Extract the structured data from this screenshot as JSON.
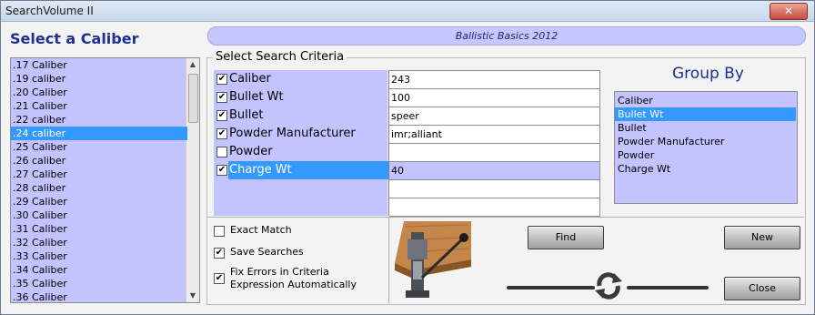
{
  "window": {
    "title": "SearchVolume II",
    "close_glyph": "✕"
  },
  "caliber_panel": {
    "heading": "Select a Caliber",
    "items": [
      ".17 Caliber",
      ".19 caliber",
      ".20 Caliber",
      ".21 Caliber",
      ".22 caliber",
      ".24 caliber",
      ".25 Caliber",
      ".26 caliber",
      ".27 Caliber",
      ".28 caliber",
      ".29 Caliber",
      ".30 Caliber",
      ".31 Caliber",
      ".32 Caliber",
      ".33 Caliber",
      ".34 Caliber",
      ".35 Caliber",
      ".36 Caliber"
    ],
    "selected_index": 5
  },
  "banner": {
    "text": "Ballistic Basics 2012"
  },
  "criteria": {
    "legend": "Select Search Criteria",
    "rows": [
      {
        "label": "Caliber",
        "checked": true,
        "value": "243"
      },
      {
        "label": "Bullet Wt",
        "checked": true,
        "value": "100"
      },
      {
        "label": "Bullet",
        "checked": true,
        "value": "speer"
      },
      {
        "label": "Powder Manufacturer",
        "checked": true,
        "value": "imr;alliant"
      },
      {
        "label": "Powder",
        "checked": false,
        "value": ""
      },
      {
        "label": "Charge Wt",
        "checked": true,
        "value": "40"
      }
    ],
    "extra_value_rows": [
      "",
      ""
    ],
    "selected_index": 5
  },
  "group_by": {
    "title": "Group By",
    "items": [
      "Caliber",
      "Bullet Wt",
      "Bullet",
      "Powder Manufacturer",
      "Powder",
      "Charge Wt"
    ],
    "selected_index": 1
  },
  "options": {
    "exact_match": {
      "label": "Exact Match",
      "checked": false
    },
    "save_searches": {
      "label": "Save Searches",
      "checked": true
    },
    "fix_errors": {
      "label_line1": "Fix Errors in Criteria",
      "label_line2": "Expression Automatically",
      "checked": true
    }
  },
  "buttons": {
    "find": "Find",
    "new": "New",
    "close": "Close"
  },
  "icons": {
    "refresh": "refresh-icon",
    "press": "reloading-press-icon"
  },
  "colors": {
    "list_bg": "#c3c3ff",
    "selection": "#3399ff",
    "heading": "#1e2f8e"
  }
}
